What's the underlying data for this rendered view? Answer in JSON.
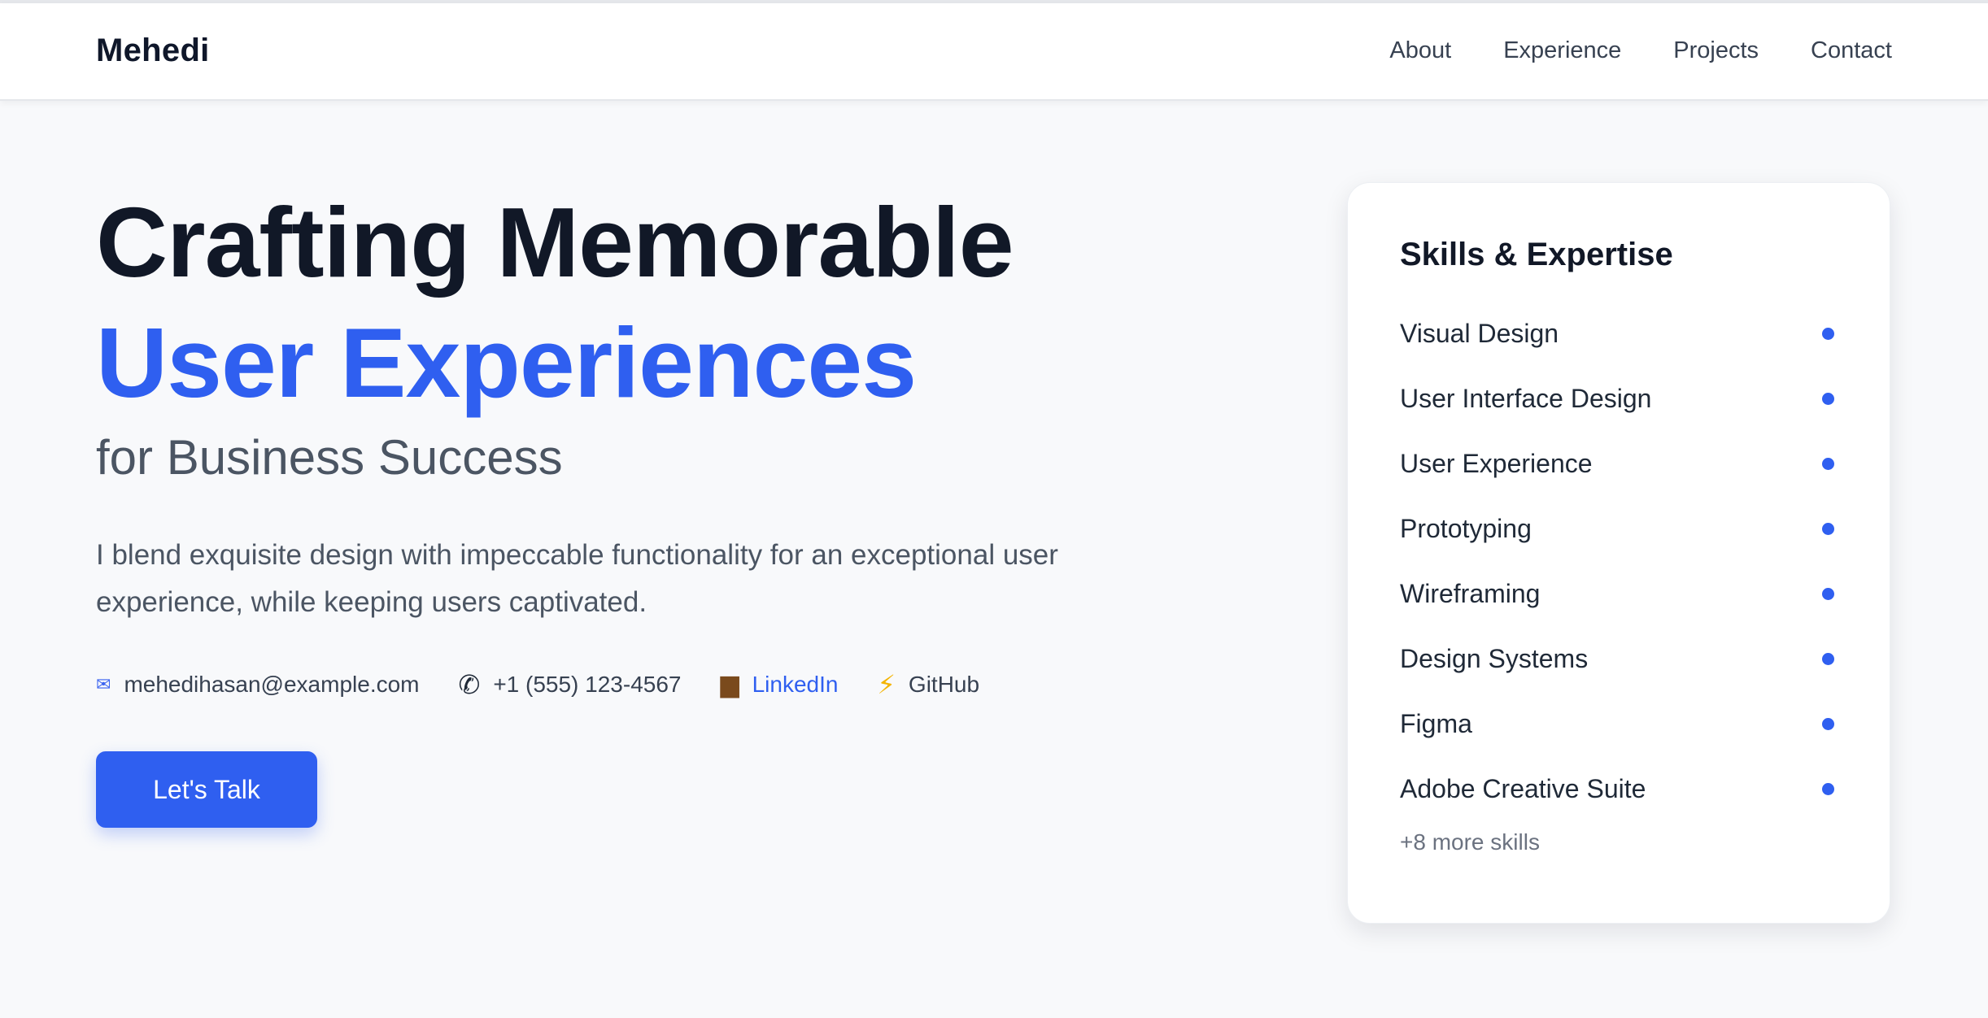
{
  "brand": "Mehedi",
  "nav": [
    "About",
    "Experience",
    "Projects",
    "Contact"
  ],
  "hero": {
    "line1": "Crafting Memorable",
    "line2": "User Experiences",
    "line3": "for Business Success",
    "description": "I blend exquisite design with impeccable functionality for an exceptional user experience, while keeping users captivated.",
    "cta": "Let's Talk"
  },
  "contacts": [
    {
      "icon": "mail-icon",
      "text": "mehedihasan@example.com"
    },
    {
      "icon": "phone-icon",
      "text": "+1 (555) 123-4567"
    },
    {
      "icon": "briefcase-icon",
      "text": "LinkedIn"
    },
    {
      "icon": "lightning-icon",
      "text": "GitHub"
    }
  ],
  "skills": {
    "title": "Skills & Expertise",
    "items": [
      "Visual Design",
      "User Interface Design",
      "User Experience",
      "Prototyping",
      "Wireframing",
      "Design Systems",
      "Figma",
      "Adobe Creative Suite"
    ],
    "more": "+8 more skills"
  },
  "colors": {
    "accent": "#2f5ff0",
    "heading": "#111827",
    "body": "#4b5563",
    "background": "#f8f9fb"
  }
}
